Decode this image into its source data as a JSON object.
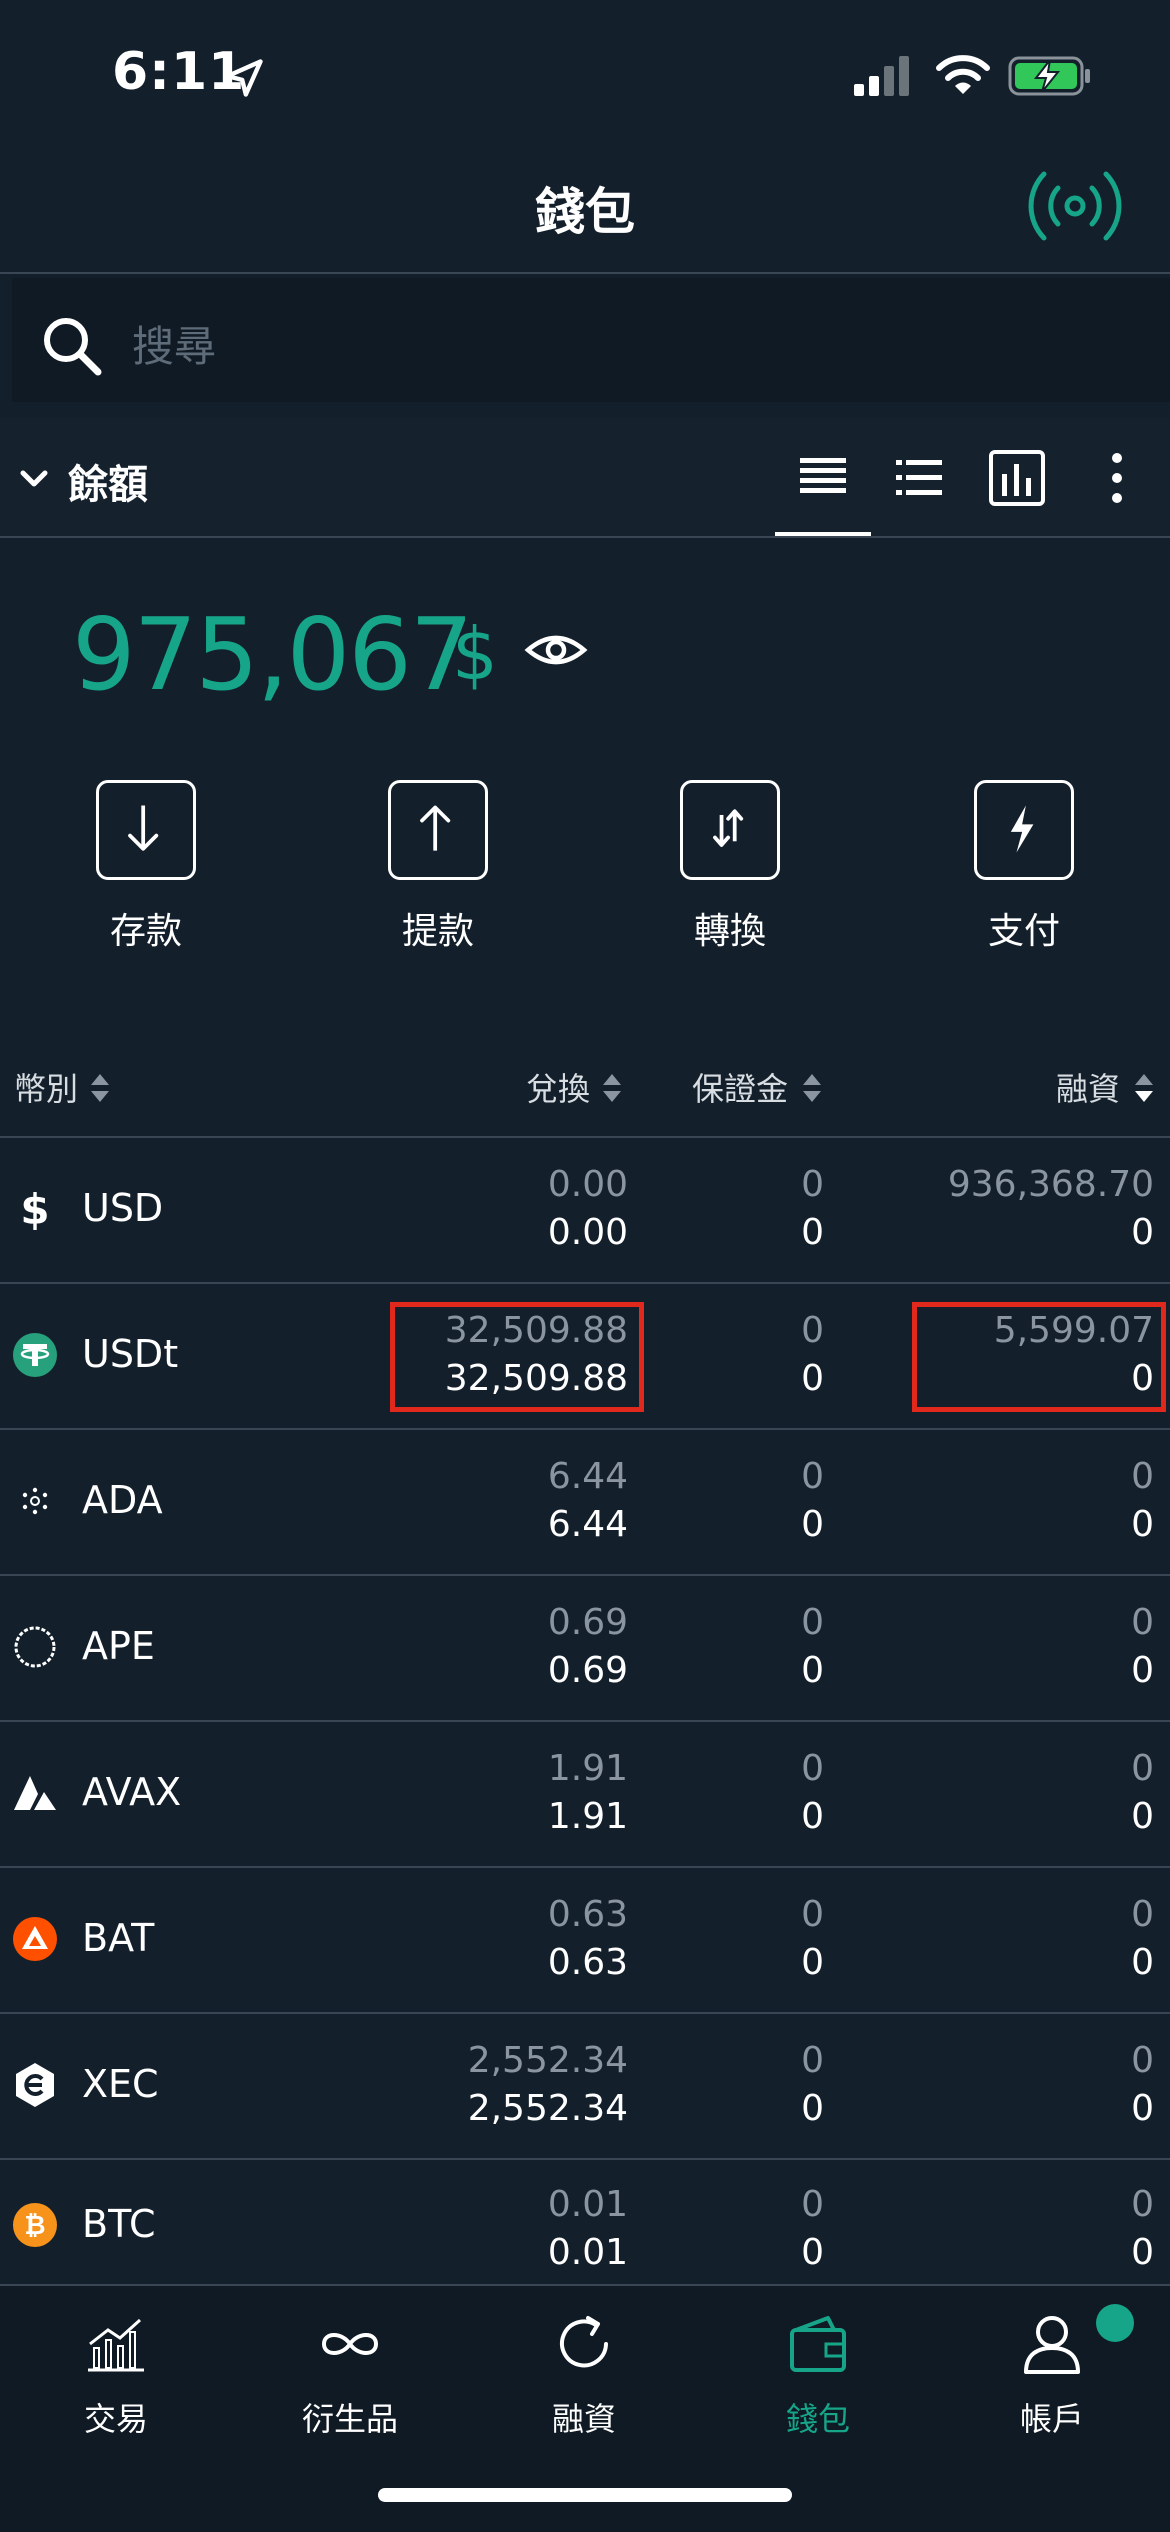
{
  "status_bar": {
    "time": "6:11"
  },
  "header": {
    "title": "錢包"
  },
  "search": {
    "placeholder": "搜尋"
  },
  "balance": {
    "label": "餘額",
    "total": "975,067",
    "currency": "$"
  },
  "actions": [
    {
      "label": "存款",
      "icon": "arrow-down-icon"
    },
    {
      "label": "提款",
      "icon": "arrow-up-icon"
    },
    {
      "label": "轉換",
      "icon": "swap-icon"
    },
    {
      "label": "支付",
      "icon": "lightning-icon"
    }
  ],
  "table": {
    "headers": {
      "currency": "幣別",
      "conversion": "兌換",
      "margin": "保證金",
      "financing": "融資"
    },
    "rows": [
      {
        "name": "USD",
        "icon": "dollar-icon",
        "conv_top": "0.00",
        "conv_bottom": "0.00",
        "margin_top": "0",
        "margin_bottom": "0",
        "fin_top": "936,368.70",
        "fin_bottom": "0"
      },
      {
        "name": "USDt",
        "icon": "tether-icon",
        "conv_top": "32,509.88",
        "conv_bottom": "32,509.88",
        "margin_top": "0",
        "margin_bottom": "0",
        "fin_top": "5,599.07",
        "fin_bottom": "0"
      },
      {
        "name": "ADA",
        "icon": "cardano-icon",
        "conv_top": "6.44",
        "conv_bottom": "6.44",
        "margin_top": "0",
        "margin_bottom": "0",
        "fin_top": "0",
        "fin_bottom": "0"
      },
      {
        "name": "APE",
        "icon": "apecoin-icon",
        "conv_top": "0.69",
        "conv_bottom": "0.69",
        "margin_top": "0",
        "margin_bottom": "0",
        "fin_top": "0",
        "fin_bottom": "0"
      },
      {
        "name": "AVAX",
        "icon": "avalanche-icon",
        "conv_top": "1.91",
        "conv_bottom": "1.91",
        "margin_top": "0",
        "margin_bottom": "0",
        "fin_top": "0",
        "fin_bottom": "0"
      },
      {
        "name": "BAT",
        "icon": "bat-icon",
        "conv_top": "0.63",
        "conv_bottom": "0.63",
        "margin_top": "0",
        "margin_bottom": "0",
        "fin_top": "0",
        "fin_bottom": "0"
      },
      {
        "name": "XEC",
        "icon": "ecash-icon",
        "conv_top": "2,552.34",
        "conv_bottom": "2,552.34",
        "margin_top": "0",
        "margin_bottom": "0",
        "fin_top": "0",
        "fin_bottom": "0"
      },
      {
        "name": "BTC",
        "icon": "bitcoin-icon",
        "conv_top": "0.01",
        "conv_bottom": "0.01",
        "margin_top": "0",
        "margin_bottom": "0",
        "fin_top": "0",
        "fin_bottom": "0"
      }
    ]
  },
  "nav": [
    {
      "label": "交易",
      "icon": "chart-icon"
    },
    {
      "label": "衍生品",
      "icon": "infinity-icon"
    },
    {
      "label": "融資",
      "icon": "refresh-icon"
    },
    {
      "label": "錢包",
      "icon": "wallet-icon",
      "active": true
    },
    {
      "label": "帳戶",
      "icon": "user-icon"
    }
  ],
  "colors": {
    "accent": "#16a589",
    "background": "#13202c",
    "highlight": "#e0281c"
  }
}
